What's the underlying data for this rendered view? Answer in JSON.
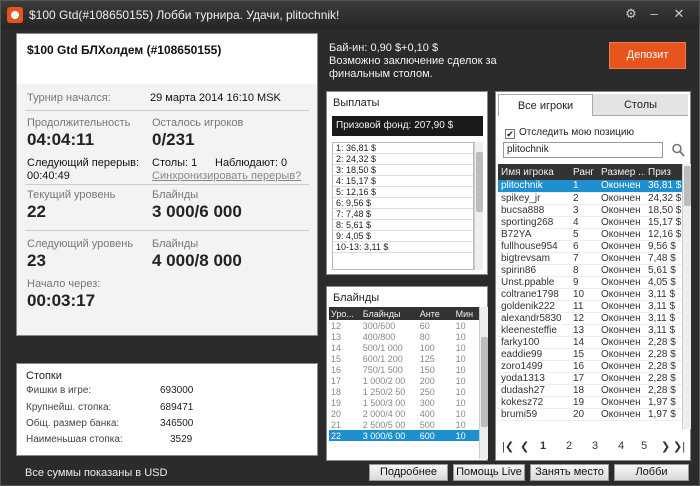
{
  "window": {
    "title": "$100 Gtd(#108650155) Лобби турнира. Удачи, plitochnik!"
  },
  "tournament": {
    "name": "$100 Gtd БЛХолдем (#108650155)",
    "started_label": "Турнир начался:",
    "started_value": "29 марта 2014   16:10 MSK",
    "duration_label": "Продолжительность",
    "duration_value": "04:04:11",
    "players_left_label": "Осталось игроков",
    "players_left_value": "0/231",
    "next_break_label": "Следующий перерыв:",
    "next_break_value": "00:40:49",
    "tables_label": "Столы: 1",
    "observers_label": "Наблюдают: 0",
    "sync_breaks_link": "Синхронизировать перерыв?",
    "current_level_label": "Текущий уровень",
    "current_level_value": "22",
    "blinds_label": "Блайнды",
    "current_blinds_value": "3 000/6 000",
    "next_level_label": "Следующий уровень",
    "next_level_value": "23",
    "next_blinds_label": "Блайнды",
    "next_blinds_value": "4 000/8 000",
    "start_in_label": "Начало через:",
    "start_in_value": "00:03:17"
  },
  "stacks": {
    "title": "Стопки",
    "rows": [
      {
        "label": "Фишки в игре:",
        "value": "693000"
      },
      {
        "label": "Крупнейш. стопка:",
        "value": "689471"
      },
      {
        "label": "Общ. размер банка:",
        "value": "346500"
      },
      {
        "label": "Наименьшая стопка:",
        "value": "3529"
      }
    ]
  },
  "footer_note": "Все суммы показаны в USD",
  "buyin": {
    "line1": "Бай-ин: 0,90 $+0,10 $",
    "line2": "Возможно заключение сделок за",
    "line3": "финальным столом."
  },
  "deposit_button": "Депозит",
  "payouts": {
    "title": "Выплаты",
    "prize_pool": "Призовой фонд: 207,90 $",
    "rows": [
      "1: 36,81 $",
      "2: 24,32 $",
      "3: 18,50 $",
      "4: 15,17 $",
      "5: 12,16 $",
      "6: 9,56 $",
      "7: 7,48 $",
      "8: 5,61 $",
      "9: 4,05 $",
      "10-13: 3,11 $"
    ]
  },
  "blinds": {
    "title": "Блайнды",
    "headers": [
      "Уро...",
      "Блайнды",
      "Анте",
      "Мин"
    ],
    "rows": [
      [
        "12",
        "300/600",
        "60",
        "10"
      ],
      [
        "13",
        "400/800",
        "80",
        "10"
      ],
      [
        "14",
        "500/1 000",
        "100",
        "10"
      ],
      [
        "15",
        "600/1 200",
        "125",
        "10"
      ],
      [
        "16",
        "750/1 500",
        "150",
        "10"
      ],
      [
        "17",
        "1 000/2 00",
        "200",
        "10"
      ],
      [
        "18",
        "1 250/2 50",
        "250",
        "10"
      ],
      [
        "19",
        "1 500/3 00",
        "300",
        "10"
      ],
      [
        "20",
        "2 000/4 00",
        "400",
        "10"
      ],
      [
        "21",
        "2 500/5 00",
        "500",
        "10"
      ],
      [
        "22",
        "3 000/6 00",
        "600",
        "10"
      ]
    ]
  },
  "players": {
    "tab_all": "Все игроки",
    "tab_tables": "Столы",
    "track_label": "Отследить мою позицию",
    "search_value": "plitochnik",
    "headers": [
      "Имя игрока",
      "Ранг",
      "Размер ...",
      "Приз"
    ],
    "rows": [
      [
        "plitochnik",
        "1",
        "Окончен",
        "36,81 $"
      ],
      [
        "spikey_jr",
        "2",
        "Окончен",
        "24,32 $"
      ],
      [
        "bucsa888",
        "3",
        "Окончен",
        "18,50 $"
      ],
      [
        "sporting268",
        "4",
        "Окончен",
        "15,17 $"
      ],
      [
        "B72YA",
        "5",
        "Окончен",
        "12,16 $"
      ],
      [
        "fullhouse954",
        "6",
        "Окончен",
        "9,56 $"
      ],
      [
        "bigtrevsam",
        "7",
        "Окончен",
        "7,48 $"
      ],
      [
        "spirin86",
        "8",
        "Окончен",
        "5,61 $"
      ],
      [
        "Unst.ppable",
        "9",
        "Окончен",
        "4,05 $"
      ],
      [
        "coltrane1798",
        "10",
        "Окончен",
        "3,11 $"
      ],
      [
        "goldenik222",
        "11",
        "Окончен",
        "3,11 $"
      ],
      [
        "alexandr5830",
        "12",
        "Окончен",
        "3,11 $"
      ],
      [
        "kleenesteffie",
        "13",
        "Окончен",
        "3,11 $"
      ],
      [
        "farky100",
        "14",
        "Окончен",
        "2,28 $"
      ],
      [
        "eaddie99",
        "15",
        "Окончен",
        "2,28 $"
      ],
      [
        "zoro1499",
        "16",
        "Окончен",
        "2,28 $"
      ],
      [
        "yoda1313",
        "17",
        "Окончен",
        "2,28 $"
      ],
      [
        "dudash27",
        "18",
        "Окончен",
        "2,28 $"
      ],
      [
        "kokesz72",
        "19",
        "Окончен",
        "1,97 $"
      ],
      [
        "brumi59",
        "20",
        "Окончен",
        "1,97 $"
      ]
    ],
    "pages": [
      "1",
      "2",
      "3",
      "4",
      "5"
    ]
  },
  "buttons": {
    "more": "Подробнее",
    "help": "Помощь Live",
    "seat": "Занять место",
    "lobby": "Лобби"
  }
}
